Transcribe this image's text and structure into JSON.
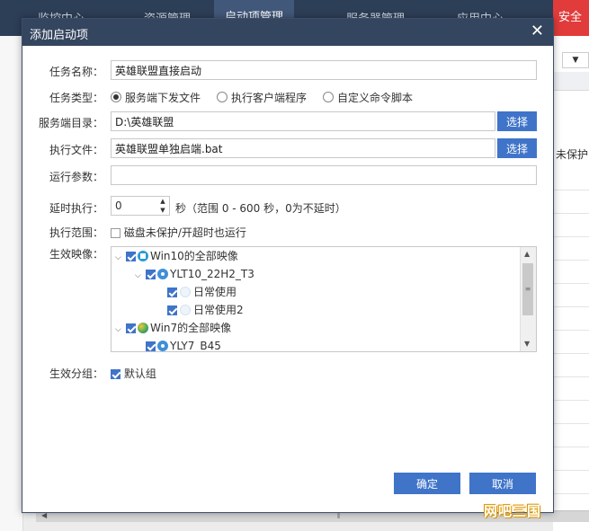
{
  "background": {
    "tabs": [
      "监控中心",
      "资源管理",
      "启动项管理",
      "服务器管理",
      "应用中心"
    ],
    "safe_label": "安全",
    "right_partial_text": "未保护"
  },
  "dialog": {
    "title": "添加启动项",
    "close_icon": "close-icon",
    "task_name": {
      "label": "任务名称：",
      "value": "英雄联盟直接启动"
    },
    "task_type": {
      "label": "任务类型：",
      "options": [
        "服务端下发文件",
        "执行客户端程序",
        "自定义命令脚本"
      ],
      "selected": "服务端下发文件"
    },
    "server_dir": {
      "label": "服务端目录：",
      "value": "D:\\英雄联盟",
      "button": "选择"
    },
    "exec_file": {
      "label": "执行文件：",
      "value": "英雄联盟单独启端.bat",
      "button": "选择"
    },
    "run_params": {
      "label": "运行参数：",
      "value": ""
    },
    "delay": {
      "label": "延时执行：",
      "value": "0",
      "hint": "秒（范围 0 - 600 秒，0为不延时）"
    },
    "exec_scope": {
      "label": "执行范围：",
      "checkbox": "磁盘未保护/开超时也运行",
      "checked": false
    },
    "images": {
      "label": "生效映像：",
      "tree": [
        {
          "text": "Win10的全部映像",
          "level": 0,
          "checked": true,
          "expanded": true,
          "icon": "windows10-icon"
        },
        {
          "text": "YLT10_22H2_T3",
          "level": 1,
          "checked": true,
          "expanded": true,
          "icon": "disc-icon"
        },
        {
          "text": "日常使用",
          "level": 2,
          "checked": true,
          "icon": "snapshot-icon"
        },
        {
          "text": "日常使用2",
          "level": 2,
          "checked": true,
          "icon": "snapshot-icon"
        },
        {
          "text": "Win7的全部映像",
          "level": 0,
          "checked": true,
          "expanded": true,
          "icon": "windows7-icon"
        },
        {
          "text": "YLY7_B45",
          "level": 1,
          "checked": true,
          "icon": "disc-icon"
        }
      ]
    },
    "group": {
      "label": "生效分组：",
      "checkbox": "默认组",
      "checked": true
    },
    "ok": "确定",
    "cancel": "取消"
  },
  "watermark": "网吧三国"
}
